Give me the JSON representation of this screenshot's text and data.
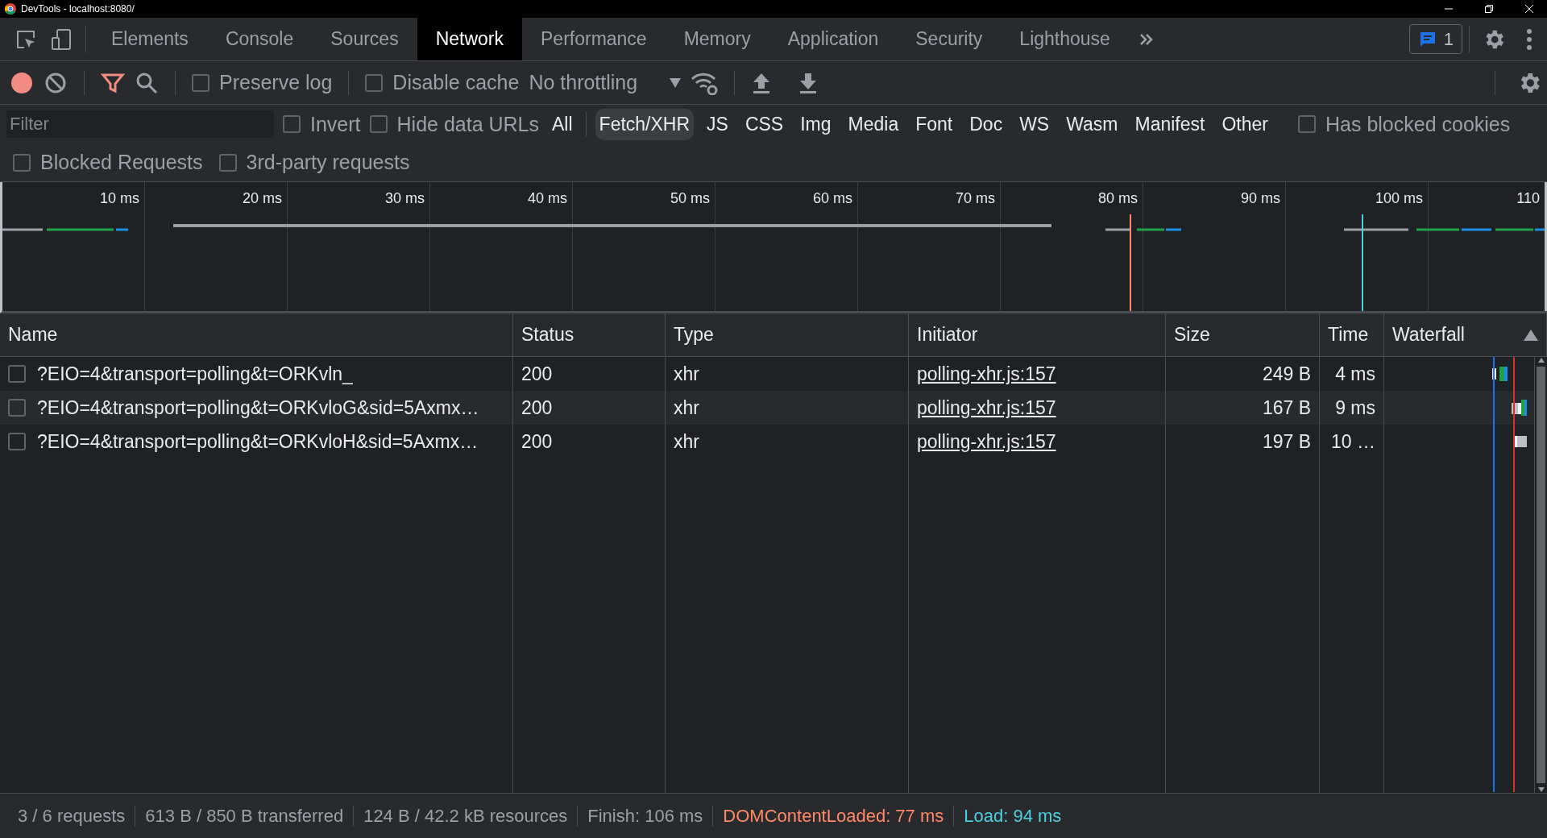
{
  "title_bar": {
    "title": "DevTools - localhost:8080/"
  },
  "tabs": [
    {
      "label": "Elements",
      "selected": false
    },
    {
      "label": "Console",
      "selected": false
    },
    {
      "label": "Sources",
      "selected": false
    },
    {
      "label": "Network",
      "selected": true
    },
    {
      "label": "Performance",
      "selected": false
    },
    {
      "label": "Memory",
      "selected": false
    },
    {
      "label": "Application",
      "selected": false
    },
    {
      "label": "Security",
      "selected": false
    },
    {
      "label": "Lighthouse",
      "selected": false
    }
  ],
  "issues_count": "1",
  "toolbar": {
    "recording": true,
    "filter_active": true,
    "preserve_log": {
      "label": "Preserve log",
      "checked": false
    },
    "disable_cache": {
      "label": "Disable cache",
      "checked": false
    },
    "throttling": "No throttling"
  },
  "filter": {
    "placeholder": "Filter",
    "invert": {
      "label": "Invert",
      "checked": false
    },
    "hide_data_urls": {
      "label": "Hide data URLs",
      "checked": false
    },
    "types": [
      {
        "label": "All",
        "selected": false
      },
      {
        "label": "Fetch/XHR",
        "selected": true
      },
      {
        "label": "JS",
        "selected": false
      },
      {
        "label": "CSS",
        "selected": false
      },
      {
        "label": "Img",
        "selected": false
      },
      {
        "label": "Media",
        "selected": false
      },
      {
        "label": "Font",
        "selected": false
      },
      {
        "label": "Doc",
        "selected": false
      },
      {
        "label": "WS",
        "selected": false
      },
      {
        "label": "Wasm",
        "selected": false
      },
      {
        "label": "Manifest",
        "selected": false
      },
      {
        "label": "Other",
        "selected": false
      }
    ],
    "has_blocked_cookies": {
      "label": "Has blocked cookies",
      "checked": false
    },
    "blocked_requests": {
      "label": "Blocked Requests",
      "checked": false
    },
    "third_party": {
      "label": "3rd-party requests",
      "checked": false
    }
  },
  "overview": {
    "ticks": [
      "10 ms",
      "20 ms",
      "30 ms",
      "40 ms",
      "50 ms",
      "60 ms",
      "70 ms",
      "80 ms",
      "90 ms",
      "100 ms",
      "110"
    ]
  },
  "table": {
    "columns": [
      "Name",
      "Status",
      "Type",
      "Initiator",
      "Size",
      "Time",
      "Waterfall"
    ],
    "rows": [
      {
        "checked": false,
        "name": "?EIO=4&transport=polling&t=ORKvln_",
        "status": "200",
        "type": "xhr",
        "initiator": "polling-xhr.js:157",
        "size": "249 B",
        "time": "4 ms"
      },
      {
        "checked": false,
        "name": "?EIO=4&transport=polling&t=ORKvloG&sid=5Axmx…",
        "status": "200",
        "type": "xhr",
        "initiator": "polling-xhr.js:157",
        "size": "167 B",
        "time": "9 ms"
      },
      {
        "checked": false,
        "name": "?EIO=4&transport=polling&t=ORKvloH&sid=5Axmx…",
        "status": "200",
        "type": "xhr",
        "initiator": "polling-xhr.js:157",
        "size": "197 B",
        "time": "10 …"
      }
    ]
  },
  "status_bar": [
    {
      "kind": "plain",
      "text": "3 / 6 requests"
    },
    {
      "kind": "plain",
      "text": "613 B / 850 B transferred"
    },
    {
      "kind": "plain",
      "text": "124 B / 42.2 kB resources"
    },
    {
      "kind": "plain",
      "text": "Finish: 106 ms"
    },
    {
      "kind": "dom",
      "text": "DOMContentLoaded: 77 ms"
    },
    {
      "kind": "load",
      "text": "Load: 94 ms"
    }
  ]
}
